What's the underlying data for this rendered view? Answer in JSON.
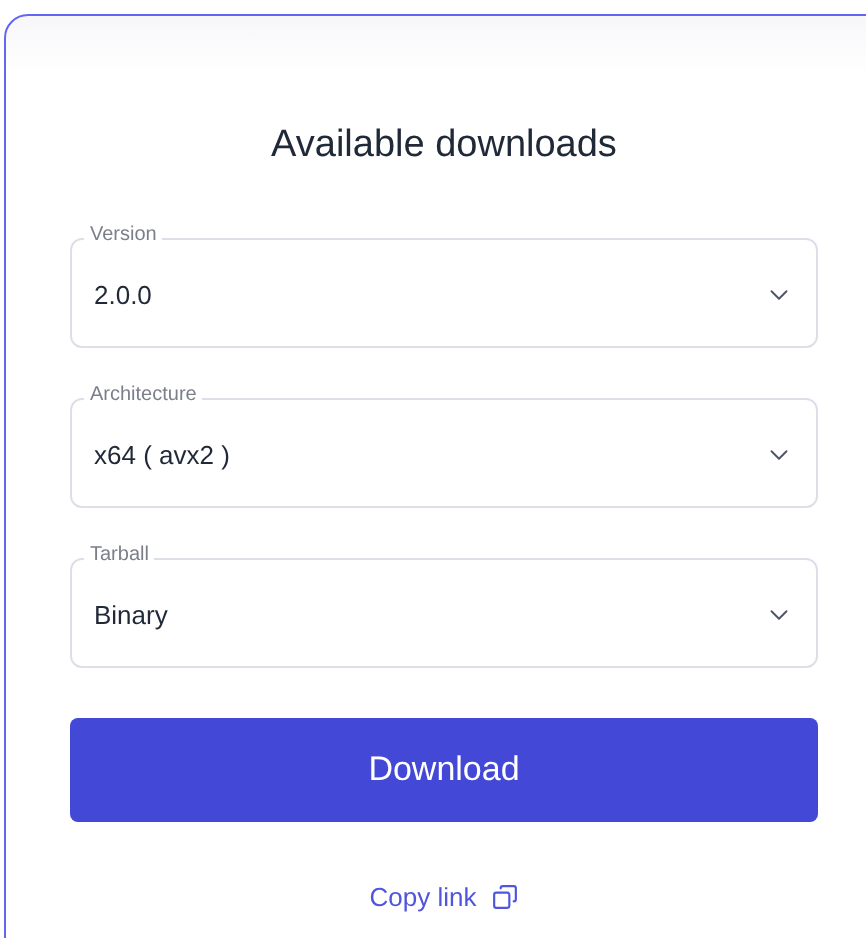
{
  "title": "Available downloads",
  "fields": [
    {
      "label": "Version",
      "value": "2.0.0"
    },
    {
      "label": "Architecture",
      "value": "x64 ( avx2 )"
    },
    {
      "label": "Tarball",
      "value": "Binary"
    }
  ],
  "download_button": "Download",
  "copy_link": "Copy link"
}
